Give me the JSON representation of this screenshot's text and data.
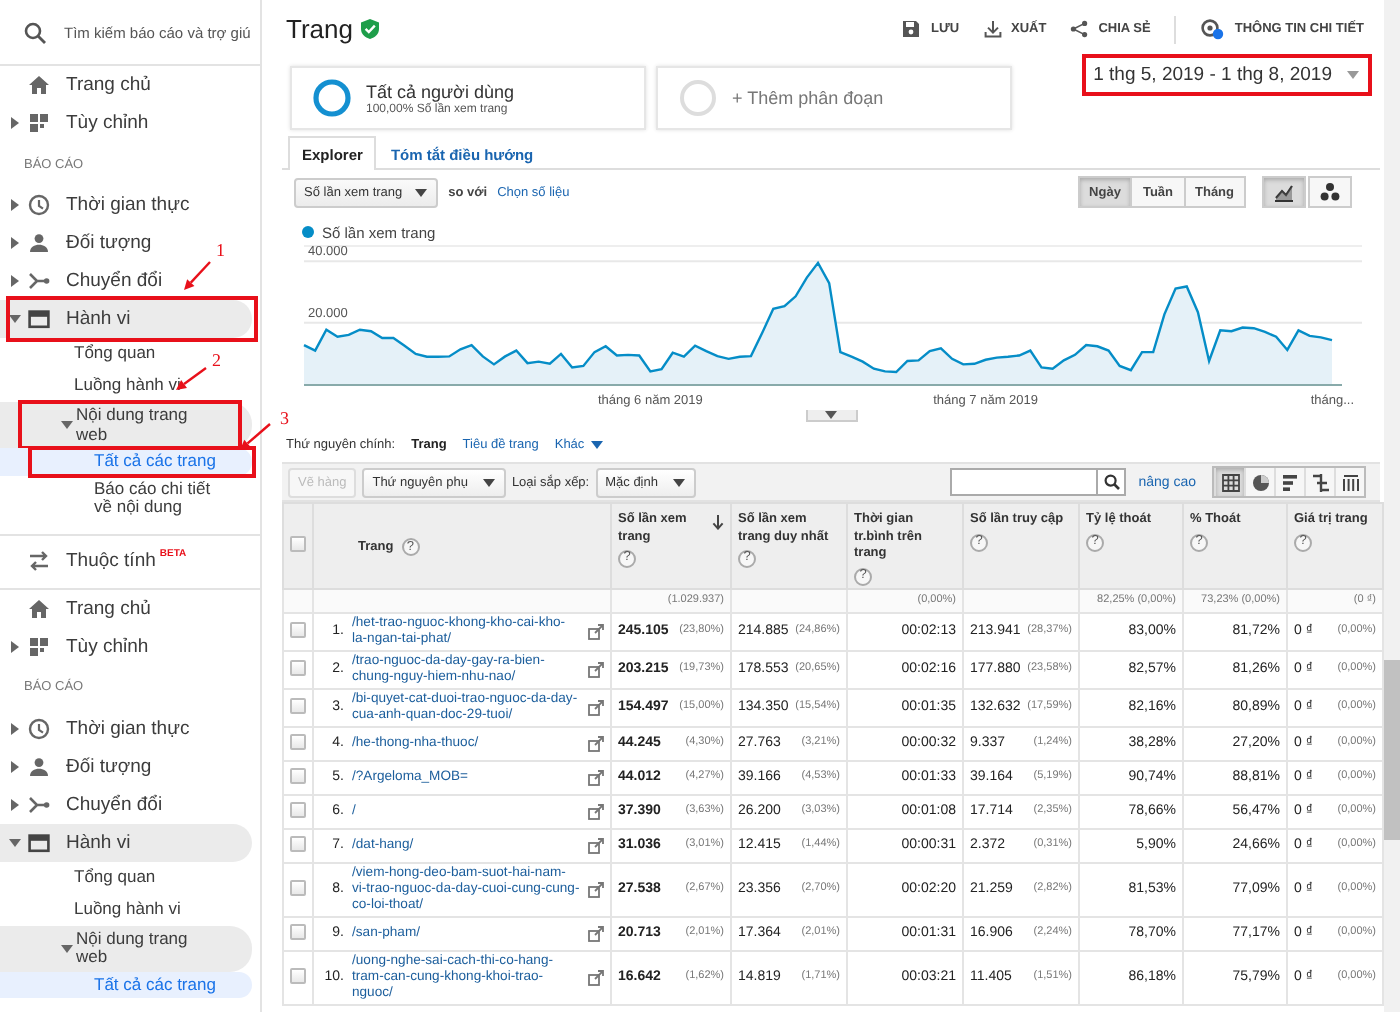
{
  "sidebar": {
    "search": {
      "placeholder": "Tìm kiếm báo cáo và trợ giú"
    },
    "panels": [
      {
        "items": [
          {
            "kind": "link",
            "label": "Trang chủ",
            "selected": false
          },
          {
            "kind": "link",
            "label": "Tùy chỉnh",
            "expanded": false,
            "selected": false
          },
          {
            "kind": "section",
            "label": "BÁO CÁO"
          },
          {
            "kind": "link",
            "label": "Thời gian thực",
            "expanded": false,
            "selected": false
          },
          {
            "kind": "link",
            "label": "Đối tượng",
            "expanded": false,
            "selected": false
          },
          {
            "kind": "link",
            "label": "Chuyển đổi",
            "expanded": false,
            "selected": false
          },
          {
            "kind": "link",
            "label": "Hành vi",
            "expanded": true,
            "selected": false,
            "outlined": true,
            "callout": "1",
            "children": [
              {
                "label": "Tổng quan",
                "selected": false
              },
              {
                "label": "Luồng hành vi",
                "selected": false
              },
              {
                "label": "Nội dung trang web",
                "expanded": true,
                "selected": false,
                "outlined": true,
                "callout": "2",
                "children": [
                  {
                    "label": "Tất cả các trang",
                    "selected": true,
                    "outlined": true,
                    "callout": "3"
                  },
                  {
                    "label": "Báo cáo chi tiết về nội dung",
                    "selected": false
                  }
                ]
              }
            ]
          }
        ],
        "footer": {
          "label": "Thuộc tính",
          "badge": "BETA"
        }
      },
      {
        "items": [
          {
            "kind": "link",
            "label": "Trang chủ",
            "selected": false
          },
          {
            "kind": "link",
            "label": "Tùy chỉnh",
            "expanded": false,
            "selected": false
          },
          {
            "kind": "section",
            "label": "BÁO CÁO"
          },
          {
            "kind": "link",
            "label": "Thời gian thực",
            "expanded": false,
            "selected": false
          },
          {
            "kind": "link",
            "label": "Đối tượng",
            "expanded": false,
            "selected": false
          },
          {
            "kind": "link",
            "label": "Chuyển đổi",
            "expanded": false,
            "selected": false
          },
          {
            "kind": "link",
            "label": "Hành vi",
            "expanded": true,
            "selected": false,
            "children": [
              {
                "label": "Tổng quan",
                "selected": false
              },
              {
                "label": "Luồng hành vi",
                "selected": false
              },
              {
                "label": "Nội dung trang web",
                "expanded": true,
                "selected": false,
                "children": [
                  {
                    "label": "Tất cả các trang",
                    "selected": true
                  }
                ]
              }
            ]
          }
        ]
      }
    ]
  },
  "header": {
    "title": "Trang",
    "verified": true,
    "actions": [
      {
        "label": "LƯU"
      },
      {
        "label": "XUẤT"
      },
      {
        "label": "CHIA SẺ"
      },
      {
        "label": "THÔNG TIN CHI TIẾT"
      }
    ]
  },
  "segments": [
    {
      "kind": "active",
      "title": "Tất cả người dùng",
      "subtitle": "100,00% Số lần xem trang"
    },
    {
      "kind": "add",
      "title": "+ Thêm phân đoạn"
    }
  ],
  "date_range": {
    "label": "1 thg 5, 2019 - 1 thg 8, 2019",
    "outlined": true
  },
  "explorer": {
    "tabs": [
      {
        "label": "Explorer",
        "selected": true
      },
      {
        "label": "Tóm tắt điều hướng",
        "selected": false
      }
    ],
    "controls": {
      "metric": "Số lần xem trang",
      "compare_label": "so với",
      "compare_link": "Chọn số liệu",
      "intervals": [
        {
          "label": "Ngày",
          "selected": true
        },
        {
          "label": "Tuần",
          "selected": false
        },
        {
          "label": "Tháng",
          "selected": false
        }
      ],
      "chart_types": [
        {
          "kind": "line",
          "selected": true
        },
        {
          "kind": "motion",
          "selected": false
        }
      ]
    },
    "chart": {
      "month_labels": [
        "tháng 6 năm 2019",
        "tháng 7 năm 2019",
        "tháng..."
      ],
      "chart_data": {
        "type": "area",
        "ylim": [
          0,
          45000
        ],
        "yticks": [
          {
            "value": 20000,
            "label": "20.000"
          },
          {
            "value": 40000,
            "label": "40.000"
          }
        ],
        "series": [
          {
            "name": "Số lần xem trang",
            "color": "#058dc7",
            "values": [
              12700,
              10900,
              17700,
              15400,
              16000,
              17700,
              17200,
              15000,
              15000,
              12500,
              9800,
              8900,
              8900,
              9000,
              11300,
              12700,
              9000,
              6400,
              9000,
              10900,
              6800,
              7300,
              6600,
              9800,
              5400,
              5900,
              10400,
              12300,
              9300,
              9500,
              9300,
              4100,
              4800,
              10200,
              8900,
              12500,
              10700,
              9100,
              8200,
              8900,
              9100,
              16600,
              24500,
              25400,
              28600,
              34700,
              39500,
              32900,
              10400,
              8900,
              7300,
              5000,
              4100,
              3900,
              7500,
              7700,
              10700,
              11600,
              8200,
              6400,
              6600,
              7900,
              8600,
              8900,
              9300,
              10900,
              5400,
              5000,
              7700,
              9500,
              12700,
              12300,
              10900,
              5900,
              4500,
              10400,
              10400,
              22700,
              31100,
              31800,
              23400,
              7500,
              17500,
              17200,
              18400,
              18200,
              17000,
              15400,
              11100,
              17500,
              15700,
              15200,
              14300
            ]
          }
        ]
      }
    }
  },
  "dimensions": {
    "label": "Thứ nguyên chính:",
    "options": [
      {
        "kind": "link",
        "label": "Trang",
        "selected": true
      },
      {
        "kind": "link",
        "label": "Tiêu đề trang",
        "selected": false
      },
      {
        "kind": "menu",
        "label": "Khác",
        "selected": false
      }
    ]
  },
  "toolbar": {
    "plot_rows": {
      "label": "Vẽ hàng",
      "disabled": true
    },
    "secondary": "Thứ nguyên phụ",
    "sort_label": "Loại sắp xếp:",
    "sort_value": "Mặc định",
    "advanced": "nâng cao",
    "views": [
      {
        "kind": "table",
        "selected": true
      },
      {
        "kind": "pie",
        "selected": false
      },
      {
        "kind": "bars",
        "selected": false
      },
      {
        "kind": "compare",
        "selected": false
      },
      {
        "kind": "pivot",
        "selected": false
      }
    ]
  },
  "table": {
    "select_all": {
      "checked": false
    },
    "columns": [
      {
        "label": "Trang",
        "help": "?",
        "sorted": false
      },
      {
        "label": "Số lần xem trang",
        "help": "?",
        "sorted": true,
        "total": "(1.029.937)"
      },
      {
        "label": "Số lần xem trang duy nhất",
        "help": "?",
        "sorted": false
      },
      {
        "label": "Thời gian tr.bình trên trang",
        "help": "?",
        "sorted": false,
        "total": "(0,00%)"
      },
      {
        "label": "Số lần truy cập",
        "help": "?",
        "sorted": false
      },
      {
        "label": "Tỷ lệ thoát",
        "help": "?",
        "sorted": false,
        "total": "82,25% (0,00%)"
      },
      {
        "label": "% Thoát",
        "help": "?",
        "sorted": false,
        "total": "73,23% (0,00%)"
      },
      {
        "label": "Giá trị trang",
        "help": "?",
        "sorted": false,
        "total": "(0 ₫)"
      }
    ],
    "rows": [
      {
        "number": "1.",
        "checked": false,
        "cells": [
          {
            "text": "/het-trao-nguoc-khong-kho-cai-kho-la-ngan-tai-phat/"
          },
          {
            "text": "245.105",
            "share": "(23,80%)"
          },
          {
            "text": "214.885",
            "share": "(24,86%)"
          },
          {
            "text": "00:02:13"
          },
          {
            "text": "213.941",
            "share": "(28,37%)"
          },
          {
            "text": "83,00%"
          },
          {
            "text": "81,72%"
          },
          {
            "text": "0 ₫",
            "share": "(0,00%)"
          }
        ]
      },
      {
        "number": "2.",
        "checked": false,
        "cells": [
          {
            "text": "/trao-nguoc-da-day-gay-ra-bien-chung-nguy-hiem-nhu-nao/"
          },
          {
            "text": "203.215",
            "share": "(19,73%)"
          },
          {
            "text": "178.553",
            "share": "(20,65%)"
          },
          {
            "text": "00:02:16"
          },
          {
            "text": "177.880",
            "share": "(23,58%)"
          },
          {
            "text": "82,57%"
          },
          {
            "text": "81,26%"
          },
          {
            "text": "0 ₫",
            "share": "(0,00%)"
          }
        ]
      },
      {
        "number": "3.",
        "checked": false,
        "cells": [
          {
            "text": "/bi-quyet-cat-duoi-trao-nguoc-da-day-cua-anh-quan-doc-29-tuoi/"
          },
          {
            "text": "154.497",
            "share": "(15,00%)"
          },
          {
            "text": "134.350",
            "share": "(15,54%)"
          },
          {
            "text": "00:01:35"
          },
          {
            "text": "132.632",
            "share": "(17,59%)"
          },
          {
            "text": "82,16%"
          },
          {
            "text": "80,89%"
          },
          {
            "text": "0 ₫",
            "share": "(0,00%)"
          }
        ]
      },
      {
        "number": "4.",
        "checked": false,
        "cells": [
          {
            "text": "/he-thong-nha-thuoc/"
          },
          {
            "text": "44.245",
            "share": "(4,30%)"
          },
          {
            "text": "27.763",
            "share": "(3,21%)"
          },
          {
            "text": "00:00:32"
          },
          {
            "text": "9.337",
            "share": "(1,24%)"
          },
          {
            "text": "38,28%"
          },
          {
            "text": "27,20%"
          },
          {
            "text": "0 ₫",
            "share": "(0,00%)"
          }
        ]
      },
      {
        "number": "5.",
        "checked": false,
        "cells": [
          {
            "text": "/?Argeloma_MOB="
          },
          {
            "text": "44.012",
            "share": "(4,27%)"
          },
          {
            "text": "39.166",
            "share": "(4,53%)"
          },
          {
            "text": "00:01:33"
          },
          {
            "text": "39.164",
            "share": "(5,19%)"
          },
          {
            "text": "90,74%"
          },
          {
            "text": "88,81%"
          },
          {
            "text": "0 ₫",
            "share": "(0,00%)"
          }
        ]
      },
      {
        "number": "6.",
        "checked": false,
        "cells": [
          {
            "text": "/"
          },
          {
            "text": "37.390",
            "share": "(3,63%)"
          },
          {
            "text": "26.200",
            "share": "(3,03%)"
          },
          {
            "text": "00:01:08"
          },
          {
            "text": "17.714",
            "share": "(2,35%)"
          },
          {
            "text": "78,66%"
          },
          {
            "text": "56,47%"
          },
          {
            "text": "0 ₫",
            "share": "(0,00%)"
          }
        ]
      },
      {
        "number": "7.",
        "checked": false,
        "cells": [
          {
            "text": "/dat-hang/"
          },
          {
            "text": "31.036",
            "share": "(3,01%)"
          },
          {
            "text": "12.415",
            "share": "(1,44%)"
          },
          {
            "text": "00:00:31"
          },
          {
            "text": "2.372",
            "share": "(0,31%)"
          },
          {
            "text": "5,90%"
          },
          {
            "text": "24,66%"
          },
          {
            "text": "0 ₫",
            "share": "(0,00%)"
          }
        ]
      },
      {
        "number": "8.",
        "checked": false,
        "cells": [
          {
            "text": "/viem-hong-deo-bam-suot-hai-nam-vi-trao-nguoc-da-day-cuoi-cung-cung-co-loi-thoat/"
          },
          {
            "text": "27.538",
            "share": "(2,67%)"
          },
          {
            "text": "23.356",
            "share": "(2,70%)"
          },
          {
            "text": "00:02:20"
          },
          {
            "text": "21.259",
            "share": "(2,82%)"
          },
          {
            "text": "81,53%"
          },
          {
            "text": "77,09%"
          },
          {
            "text": "0 ₫",
            "share": "(0,00%)"
          }
        ]
      },
      {
        "number": "9.",
        "checked": false,
        "cells": [
          {
            "text": "/san-pham/"
          },
          {
            "text": "20.713",
            "share": "(2,01%)"
          },
          {
            "text": "17.364",
            "share": "(2,01%)"
          },
          {
            "text": "00:01:31"
          },
          {
            "text": "16.906",
            "share": "(2,24%)"
          },
          {
            "text": "78,70%"
          },
          {
            "text": "77,17%"
          },
          {
            "text": "0 ₫",
            "share": "(0,00%)"
          }
        ]
      },
      {
        "number": "10.",
        "checked": false,
        "cells": [
          {
            "text": "/uong-nghe-sai-cach-thi-co-hang-tram-can-cung-khong-khoi-trao-nguoc/"
          },
          {
            "text": "16.642",
            "share": "(1,62%)"
          },
          {
            "text": "14.819",
            "share": "(1,71%)"
          },
          {
            "text": "00:03:21"
          },
          {
            "text": "11.405",
            "share": "(1,51%)"
          },
          {
            "text": "86,18%"
          },
          {
            "text": "75,79%"
          },
          {
            "text": "0 ₫",
            "share": "(0,00%)"
          }
        ]
      }
    ]
  }
}
